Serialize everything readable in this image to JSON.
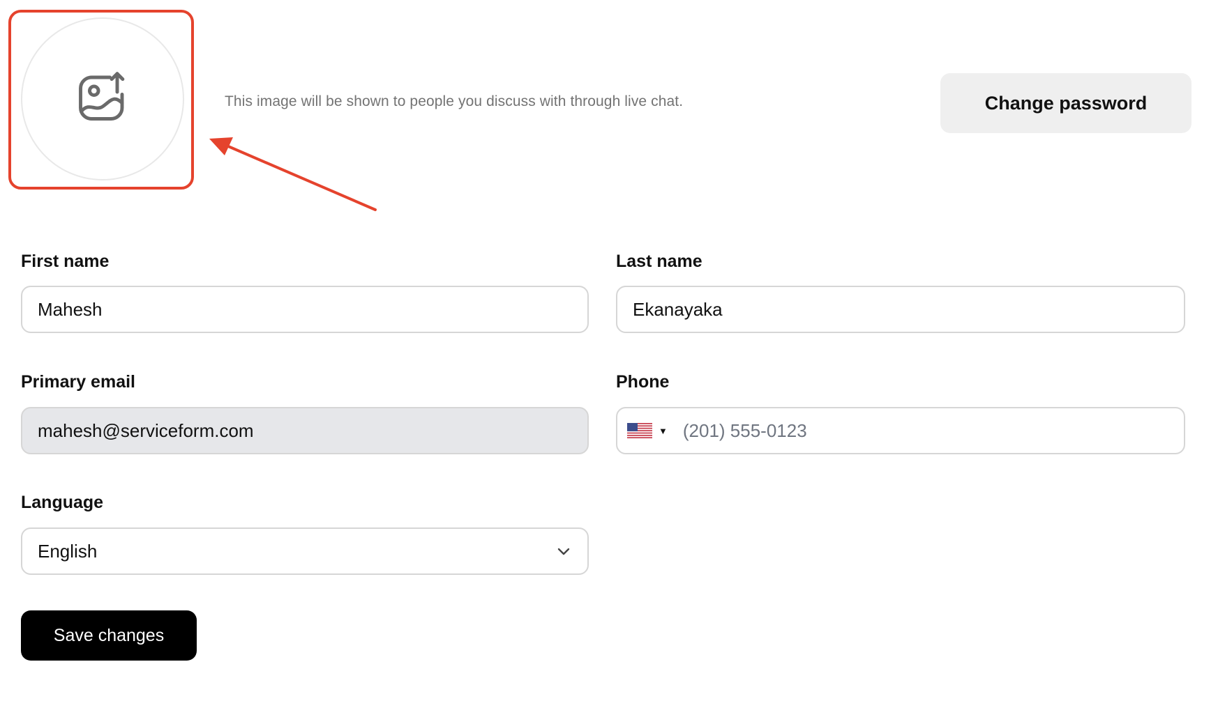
{
  "avatar": {
    "icon": "image-upload-icon",
    "hint": "This image will be shown to people you discuss with through live chat."
  },
  "header": {
    "change_password_label": "Change password"
  },
  "form": {
    "first_name": {
      "label": "First name",
      "value": "Mahesh"
    },
    "last_name": {
      "label": "Last name",
      "value": "Ekanayaka"
    },
    "primary_email": {
      "label": "Primary email",
      "value": "mahesh@serviceform.com"
    },
    "phone": {
      "label": "Phone",
      "value": "",
      "placeholder": "(201) 555-0123",
      "country_icon": "us-flag-icon"
    },
    "language": {
      "label": "Language",
      "selected": "English"
    }
  },
  "actions": {
    "save_label": "Save changes"
  },
  "colors": {
    "highlight": "#e5432d",
    "primary_button": "#000000",
    "secondary_button": "#efefef",
    "disabled_field": "#e6e7ea"
  }
}
